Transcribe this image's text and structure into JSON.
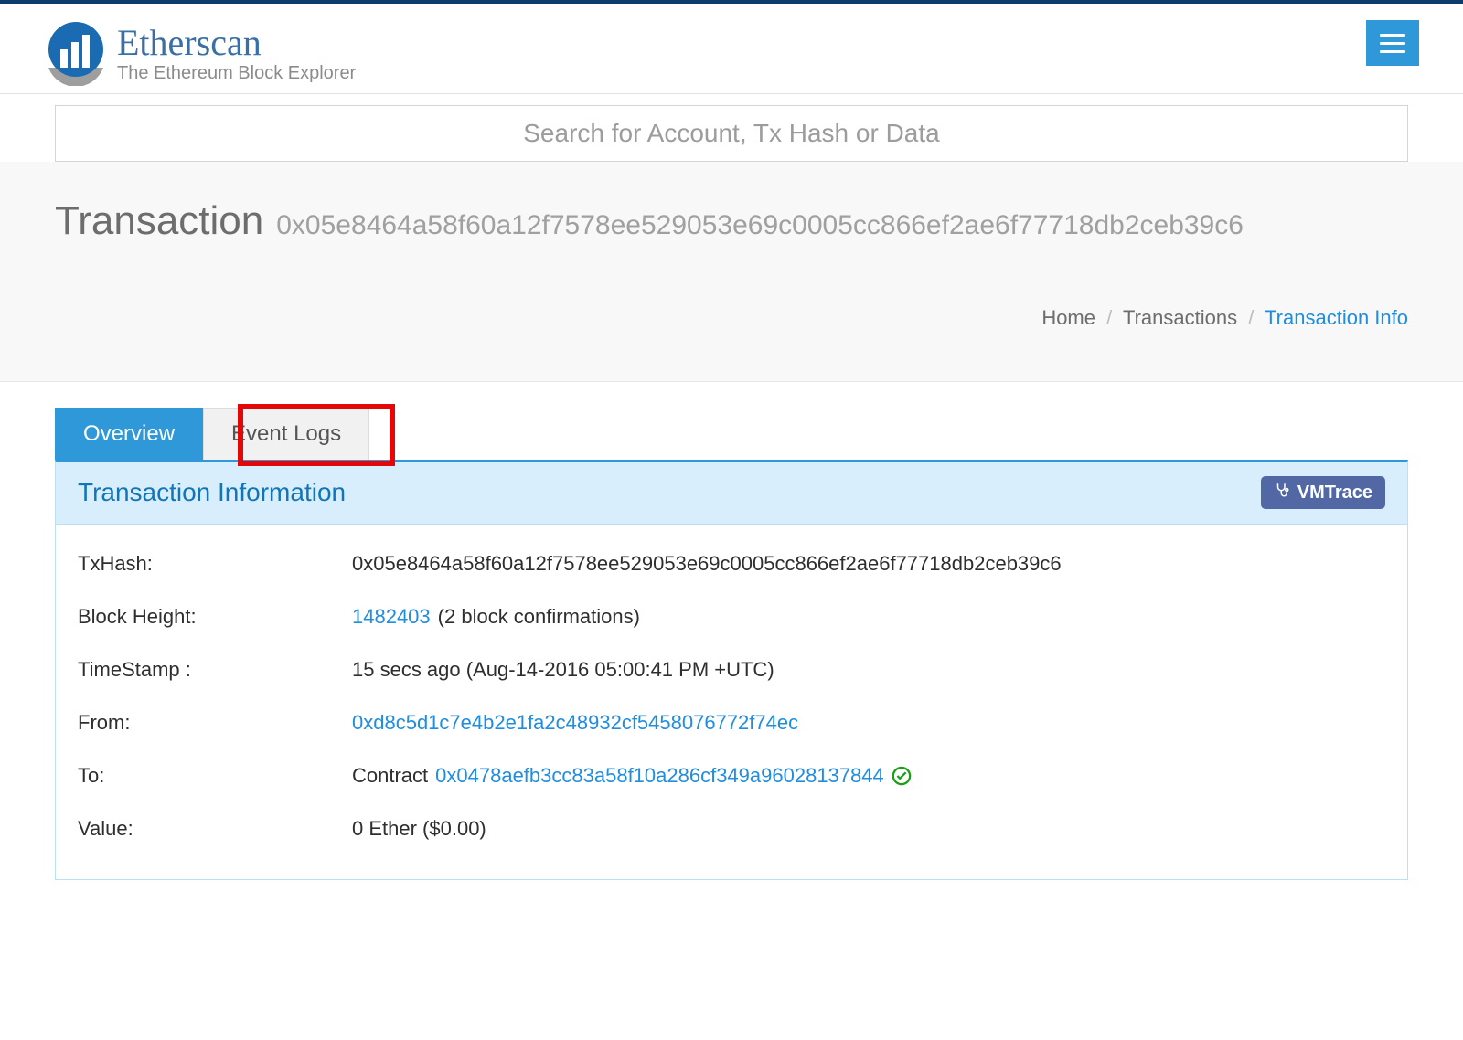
{
  "brand": {
    "name": "Etherscan",
    "tagline": "The Ethereum Block Explorer"
  },
  "search": {
    "placeholder": "Search for Account, Tx Hash or Data"
  },
  "page": {
    "title": "Transaction",
    "hash": "0x05e8464a58f60a12f7578ee529053e69c0005cc866ef2ae6f77718db2ceb39c6"
  },
  "breadcrumb": {
    "home": "Home",
    "transactions": "Transactions",
    "current": "Transaction Info"
  },
  "tabs": {
    "overview": "Overview",
    "event_logs": "Event Logs"
  },
  "panel": {
    "title": "Transaction Information",
    "vmtrace": "VMTrace"
  },
  "fields": {
    "txhash_label": "TxHash:",
    "txhash_value": "0x05e8464a58f60a12f7578ee529053e69c0005cc866ef2ae6f77718db2ceb39c6",
    "block_label": "Block Height:",
    "block_link": "1482403",
    "block_confirm": "(2 block confirmations)",
    "timestamp_label": "TimeStamp :",
    "timestamp_value": "15 secs ago (Aug-14-2016 05:00:41 PM +UTC)",
    "from_label": "From:",
    "from_value": "0xd8c5d1c7e4b2e1fa2c48932cf5458076772f74ec",
    "to_label": "To:",
    "to_prefix": "Contract",
    "to_value": "0x0478aefb3cc83a58f10a286cf349a96028137844",
    "value_label": "Value:",
    "value_value": "0 Ether ($0.00)"
  }
}
